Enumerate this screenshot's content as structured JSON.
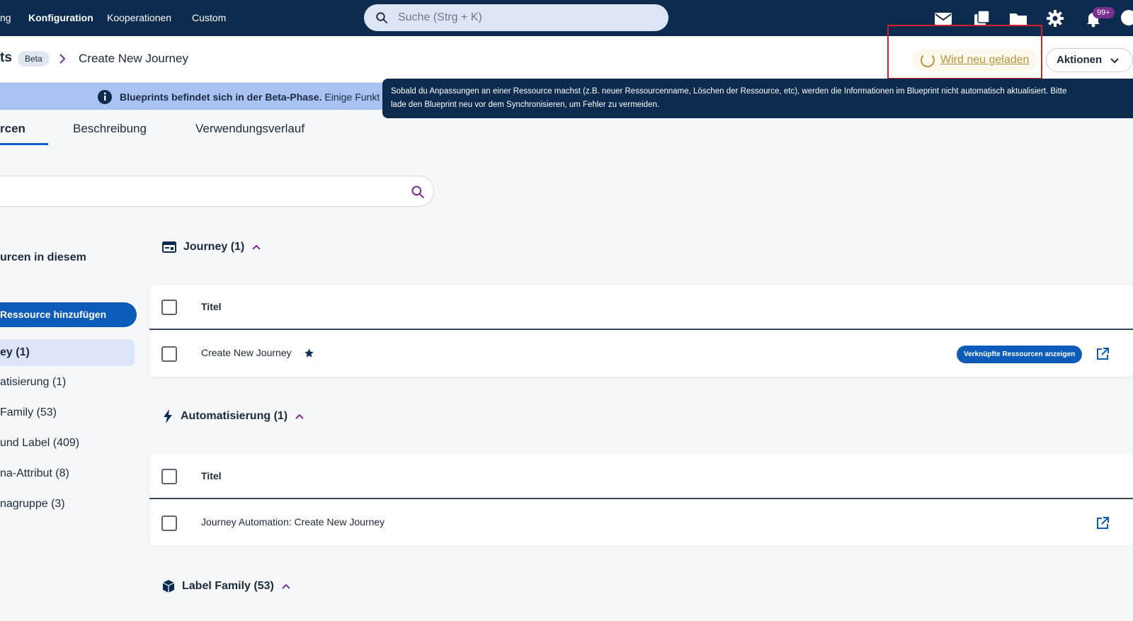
{
  "nav": {
    "items": [
      "ng",
      "Konfiguration",
      "Kooperationen",
      "Custom"
    ],
    "active_index": 1,
    "search_placeholder": "Suche (Strg + K)",
    "icons": [
      "mail-icon",
      "copy-icon",
      "folder-icon",
      "gear-icon",
      "bell-icon",
      "info-icon"
    ],
    "notification_badge": "99+"
  },
  "header": {
    "crumb_partial": "ts",
    "beta_label": "Beta",
    "crumb_title": "Create New Journey",
    "reload_label": "Wird neu geladen",
    "actions_label": "Aktionen"
  },
  "banner": {
    "bold": "Blueprints befindet sich in der Beta-Phase.",
    "text": "Einige Funkt"
  },
  "tooltip": {
    "line1": "Sobald du Anpassungen an einer Ressource machst (z.B. neuer Ressourcenname, Löschen der Ressource, etc), werden die Informationen im Blueprint nicht automatisch aktualisiert. Bitte",
    "line2": "lade den Blueprint neu vor dem Synchronisieren, um Fehler zu vermeiden."
  },
  "tabs": [
    "rcen",
    "Beschreibung",
    "Verwendungsverlauf"
  ],
  "left_panel": {
    "heading": "urcen in diesem",
    "add_button": "Ressource hinzufügen",
    "items": [
      "ey (1)",
      "atisierung (1)",
      "Family (53)",
      "und Label (409)",
      "na-Attribut (8)",
      "nagruppe (3)"
    ]
  },
  "sections": [
    {
      "title": "Journey (1)",
      "header": "Titel",
      "rows": [
        {
          "title": "Create New Journey",
          "starred": true,
          "linked_button": "Verknüpfte Ressourcen anzeigen"
        }
      ]
    },
    {
      "title": "Automatisierung (1)",
      "header": "Titel",
      "rows": [
        {
          "title": "Journey Automation: Create New Journey"
        }
      ]
    },
    {
      "title": "Label Family (53)"
    }
  ],
  "colors": {
    "nav_bg": "#0c2b4e",
    "primary": "#0c5bb8",
    "accent": "#7a2e8f",
    "highlight_box": "#d41f2c"
  }
}
